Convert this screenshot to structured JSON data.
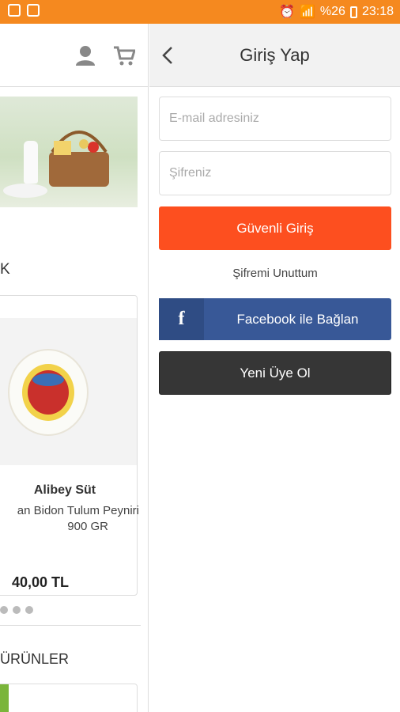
{
  "status_bar": {
    "battery": "%26",
    "time": "23:18"
  },
  "left_page": {
    "section_title_fragment": "K",
    "product": {
      "brand": "Alibey Süt",
      "name": "an Bidon Tulum Peyniri",
      "weight": "900 GR",
      "price": "40,00 TL"
    },
    "section2_title": "ÜRÜNLER"
  },
  "login": {
    "title": "Giriş Yap",
    "email_placeholder": "E-mail adresiniz",
    "password_placeholder": "Şifreniz",
    "login_button": "Güvenli Giriş",
    "forgot_link": "Şifremi Unuttum",
    "facebook_icon": "f",
    "facebook_button": "Facebook ile Bağlan",
    "register_button": "Yeni Üye Ol"
  },
  "colors": {
    "status_bar": "#f5891f",
    "login_button": "#fd4f1f",
    "facebook": "#385897",
    "register": "#363636"
  }
}
